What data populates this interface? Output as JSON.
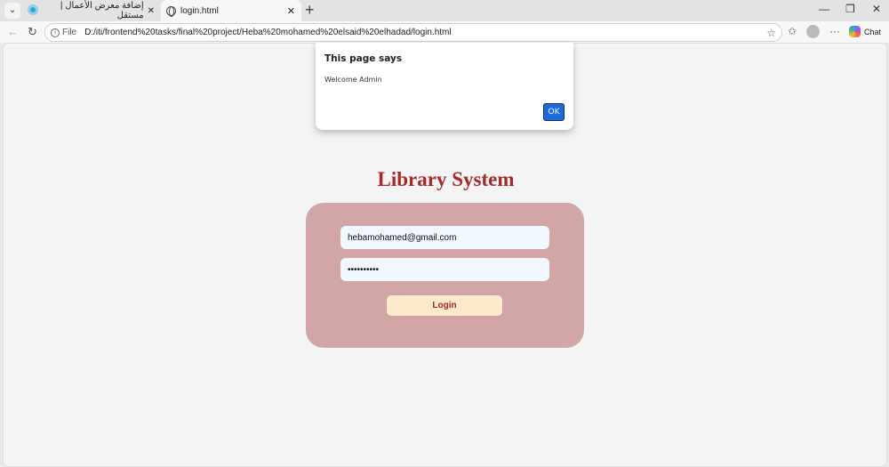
{
  "browser": {
    "tabs": [
      {
        "label": "إضافة معرض الأعمال | مستقل",
        "close": "✕"
      },
      {
        "label": "login.html",
        "close": "✕"
      }
    ],
    "new_tab": "+",
    "address": {
      "scheme_label": "File",
      "url": "D:/iti/frontend%20tasks/final%20project/Heba%20mohamed%20elsaid%20elhadad/login.html"
    },
    "chat_label": "Chat",
    "more": "···"
  },
  "page": {
    "title": "Library System",
    "email_value": "hebamohamed@gmail.com",
    "password_value": "••••••••••",
    "login_label": "Login"
  },
  "dialog": {
    "title": "This page says",
    "message": "Welcome Admin",
    "ok_label": "OK"
  }
}
